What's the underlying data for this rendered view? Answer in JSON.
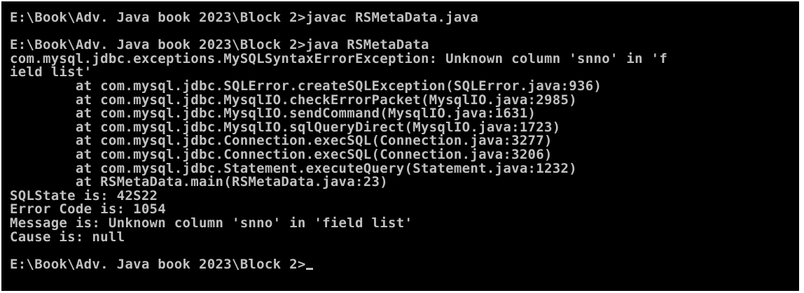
{
  "console": {
    "lines": [
      "E:\\Book\\Adv. Java book 2023\\Block 2>javac RSMetaData.java",
      "",
      "E:\\Book\\Adv. Java book 2023\\Block 2>java RSMetaData",
      "com.mysql.jdbc.exceptions.MySQLSyntaxErrorException: Unknown column 'snno' in 'f",
      "ield list'",
      "        at com.mysql.jdbc.SQLError.createSQLException(SQLError.java:936)",
      "        at com.mysql.jdbc.MysqlIO.checkErrorPacket(MysqlIO.java:2985)",
      "        at com.mysql.jdbc.MysqlIO.sendCommand(MysqlIO.java:1631)",
      "        at com.mysql.jdbc.MysqlIO.sqlQueryDirect(MysqlIO.java:1723)",
      "        at com.mysql.jdbc.Connection.execSQL(Connection.java:3277)",
      "        at com.mysql.jdbc.Connection.execSQL(Connection.java:3206)",
      "        at com.mysql.jdbc.Statement.executeQuery(Statement.java:1232)",
      "        at RSMetaData.main(RSMetaData.java:23)",
      "SQLState is: 42S22",
      "Error Code is: 1054",
      "Message is: Unknown column 'snno' in 'field list'",
      "Cause is: null",
      "",
      "E:\\Book\\Adv. Java book 2023\\Block 2>"
    ]
  },
  "colors": {
    "background": "#000000",
    "text": "#c0c0c0"
  }
}
